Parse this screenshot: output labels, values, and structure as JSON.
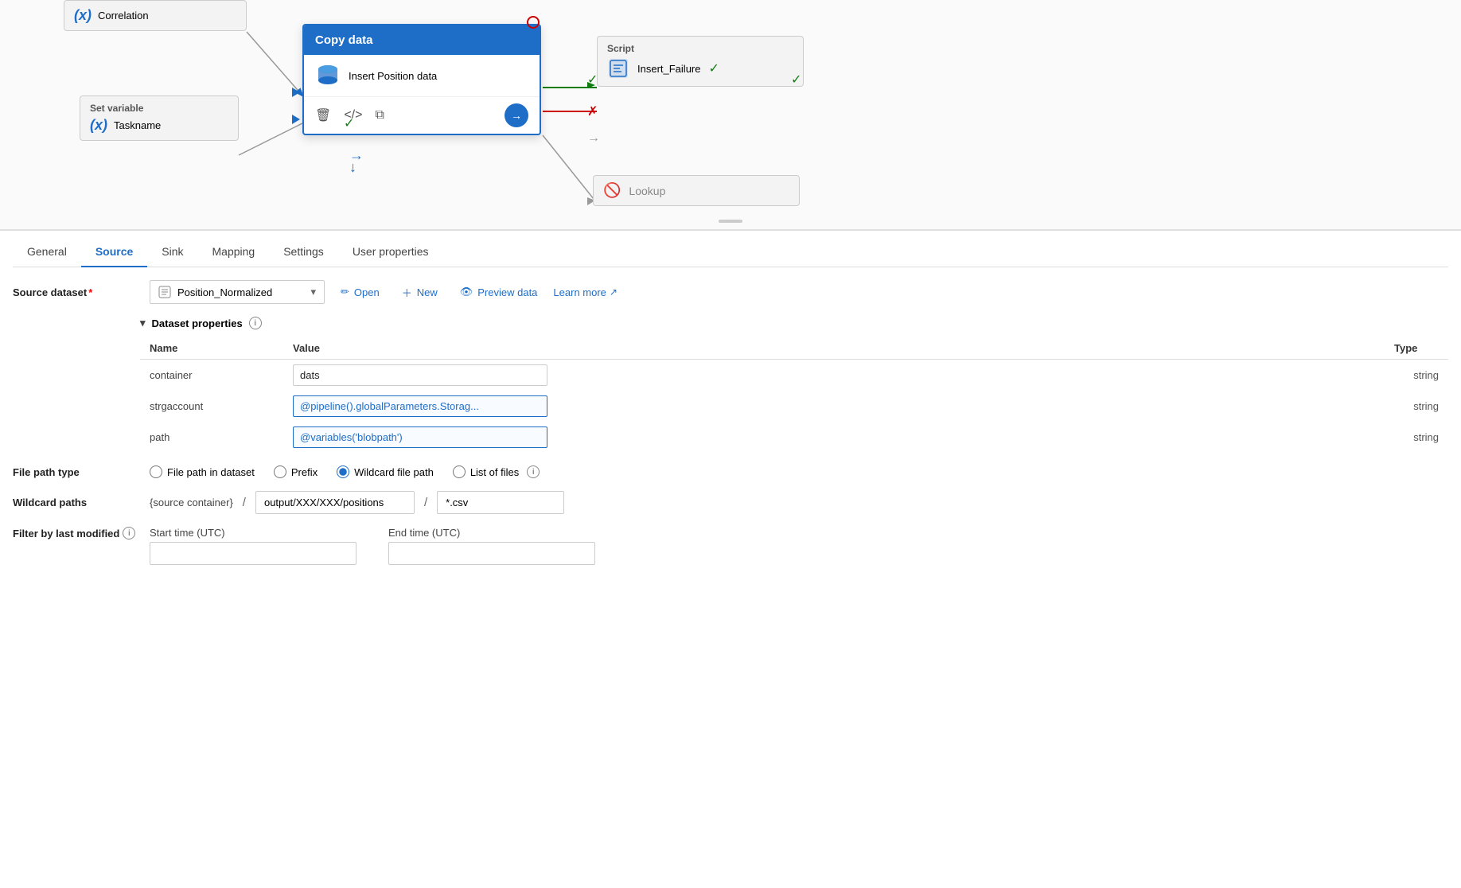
{
  "canvas": {
    "nodes": {
      "correlation": {
        "title": "Correlation",
        "icon": "fx"
      },
      "setVariable": {
        "title": "Set variable",
        "item": "Taskname",
        "icon": "fx"
      },
      "copyData": {
        "header": "Copy data",
        "item": "Insert Position data",
        "icon": "database"
      },
      "script": {
        "title": "Script",
        "item": "Insert_Failure",
        "icon": "script"
      },
      "lookup": {
        "title": "Lookup",
        "icon": "lookup"
      }
    }
  },
  "tabs": {
    "items": [
      "General",
      "Source",
      "Sink",
      "Mapping",
      "Settings",
      "User properties"
    ],
    "active": "Source"
  },
  "source": {
    "datasetLabel": "Source dataset",
    "datasetValue": "Position_Normalized",
    "openLabel": "Open",
    "newLabel": "New",
    "previewLabel": "Preview data",
    "learnMoreLabel": "Learn more",
    "datasetPropertiesLabel": "Dataset properties",
    "table": {
      "columns": [
        "Name",
        "Value",
        "Type"
      ],
      "rows": [
        {
          "name": "container",
          "value": "dats",
          "type": "string",
          "expression": false
        },
        {
          "name": "strgaccount",
          "value": "@pipeline().globalParameters.Storag...",
          "type": "string",
          "expression": true
        },
        {
          "name": "path",
          "value": "@variables('blobpath')",
          "type": "string",
          "expression": true
        }
      ]
    },
    "filePathType": {
      "label": "File path type",
      "options": [
        {
          "id": "filepath",
          "label": "File path in dataset"
        },
        {
          "id": "prefix",
          "label": "Prefix"
        },
        {
          "id": "wildcard",
          "label": "Wildcard file path",
          "selected": true
        },
        {
          "id": "listfiles",
          "label": "List of files"
        }
      ]
    },
    "wildcardPaths": {
      "label": "Wildcard paths",
      "sourceContainer": "{source container}",
      "slash": "/",
      "folderInput": "output/XXX/XXX/positions",
      "fileInput": "*.csv"
    },
    "filterByLastModified": {
      "label": "Filter by last modified",
      "startTimeLabel": "Start time (UTC)",
      "endTimeLabel": "End time (UTC)",
      "startValue": "",
      "endValue": ""
    }
  }
}
